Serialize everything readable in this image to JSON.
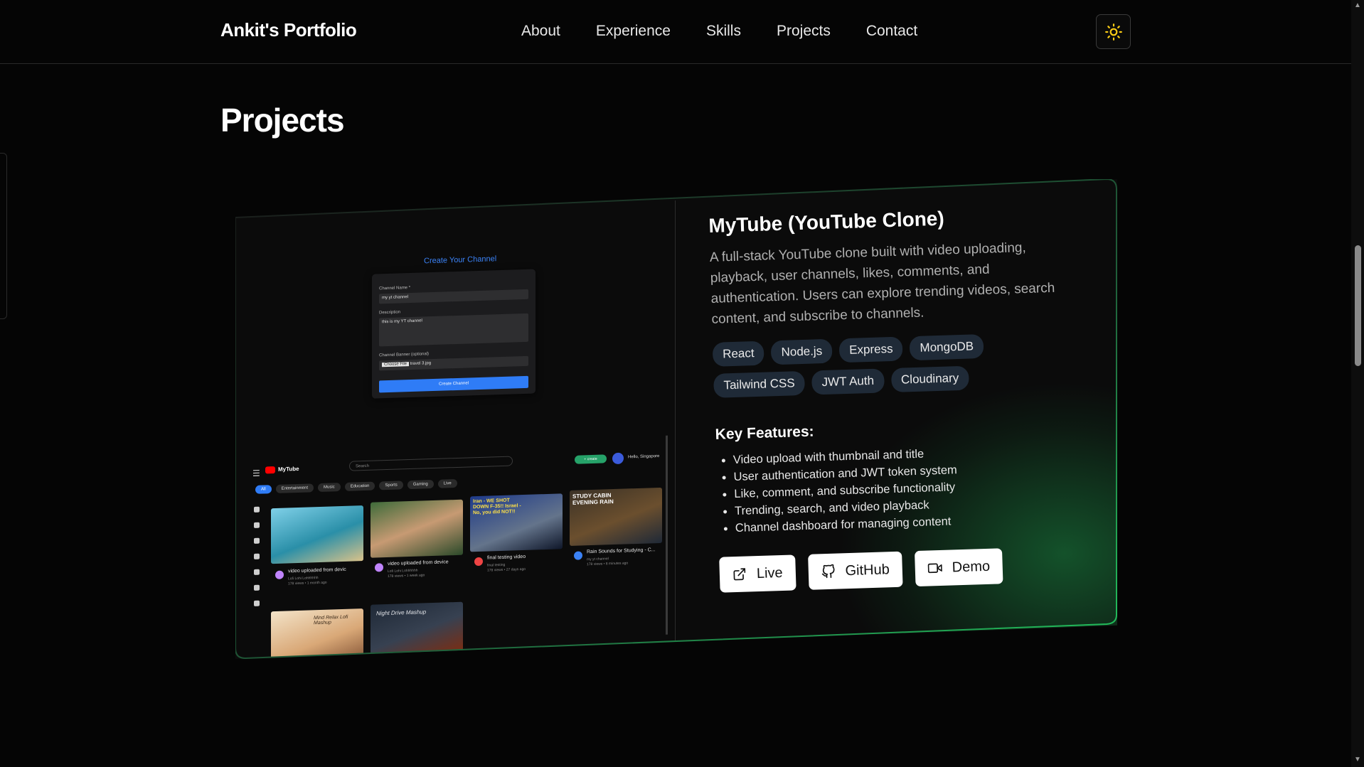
{
  "nav": {
    "brand": "Ankit's Portfolio",
    "links": [
      "About",
      "Experience",
      "Skills",
      "Projects",
      "Contact"
    ],
    "theme_icon": "sun-icon"
  },
  "section": {
    "title": "Projects"
  },
  "project": {
    "title": "MyTube (YouTube Clone)",
    "description": "A full-stack YouTube clone built with video uploading, playback, user channels, likes, comments, and authentication. Users can explore trending videos, search content, and subscribe to channels.",
    "tags": [
      "React",
      "Node.js",
      "Express",
      "MongoDB",
      "Tailwind CSS",
      "JWT Auth",
      "Cloudinary"
    ],
    "features_title": "Key Features:",
    "features": [
      "Video upload with thumbnail and title",
      "User authentication and JWT token system",
      "Like, comment, and subscribe functionality",
      "Trending, search, and video playback",
      "Channel dashboard for managing content"
    ],
    "actions": [
      {
        "label": "Live",
        "icon": "external-link-icon"
      },
      {
        "label": "GitHub",
        "icon": "github-icon"
      },
      {
        "label": "Demo",
        "icon": "video-icon"
      }
    ],
    "accent_color": "#22c55e"
  },
  "screenshot": {
    "create_title": "Create Your Channel",
    "fields": {
      "name_label": "Channel Name *",
      "name_value": "my yt channel",
      "desc_label": "Description",
      "desc_value": "this is my YT channel",
      "banner_label": "Channel Banner (optional)",
      "file_button": "Choose File",
      "file_name": "travel 3.jpg",
      "submit": "Create Channel"
    },
    "app_name": "MyTube",
    "search_placeholder": "Search",
    "create_label": "+ create",
    "greeting": "Hello, Singapore",
    "chips": [
      "All",
      "Entertainment",
      "Music",
      "Education",
      "Sports",
      "Gaming",
      "Live"
    ],
    "videos": [
      {
        "title": "video uploaded from devic",
        "channel": "Lofi Lohi Lohhhhhh",
        "meta": "178 views • 1 month ago"
      },
      {
        "title": "video uploaded from device",
        "channel": "Lofi Lohi Lohhhhhh",
        "meta": "178 views • 1 week ago"
      },
      {
        "title": "final testing video",
        "channel": "final testing",
        "meta": "178 views • 27 days ago"
      },
      {
        "title": "Rain Sounds for Studying - C...",
        "channel": "my yt channel",
        "meta": "178 views • 8 minutes ago"
      }
    ],
    "thumb_texts": {
      "t3": "Iran - WE SHOT DOWN F-35!! Israel - No, you did NOT!!",
      "t4": "STUDY CABIN EVENING RAIN",
      "t5": "Mind Relax Lofi Mashup",
      "t6": "Night Drive Mashup"
    }
  }
}
